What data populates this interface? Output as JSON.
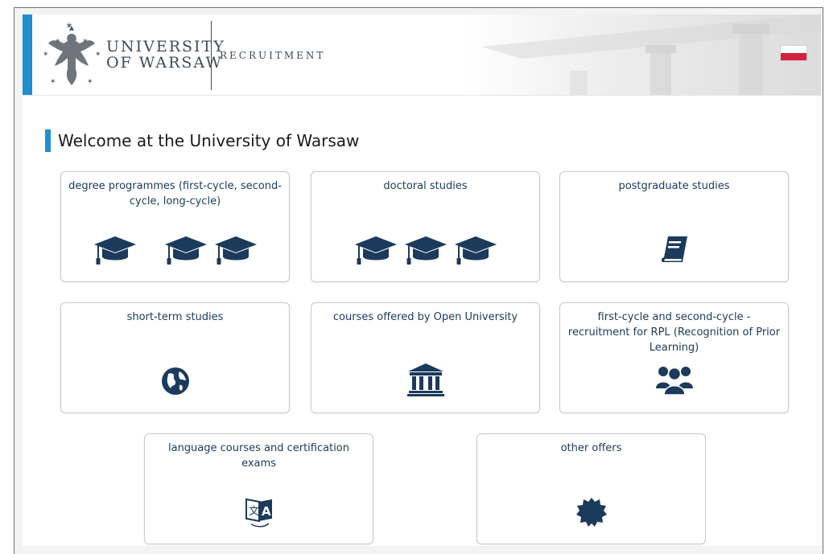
{
  "header": {
    "logo_line1": "UNIVERSITY",
    "logo_line2": "OF WARSAW",
    "section": "RECRUITMENT",
    "language_flag": "polish-flag-icon"
  },
  "page_title": "Welcome at the University of Warsaw",
  "colors": {
    "accent": "#1f8fcf",
    "icon": "#1b3a5c",
    "text": "#1b3a5c"
  },
  "cards": [
    {
      "label": "degree programmes (first-cycle, second-cycle, long-cycle)",
      "icon": "graduation-cap-icon"
    },
    {
      "label": "doctoral studies",
      "icon": "graduation-cap-icon"
    },
    {
      "label": "postgraduate studies",
      "icon": "book-icon"
    },
    {
      "label": "short-term studies",
      "icon": "globe-icon"
    },
    {
      "label": "courses offered by Open University",
      "icon": "university-building-icon"
    },
    {
      "label": "first-cycle and second-cycle - recruitment for RPL (Recognition of Prior Learning)",
      "icon": "users-group-icon"
    },
    {
      "label": "language courses and certification exams",
      "icon": "translate-icon"
    },
    {
      "label": "other offers",
      "icon": "badge-icon"
    }
  ]
}
